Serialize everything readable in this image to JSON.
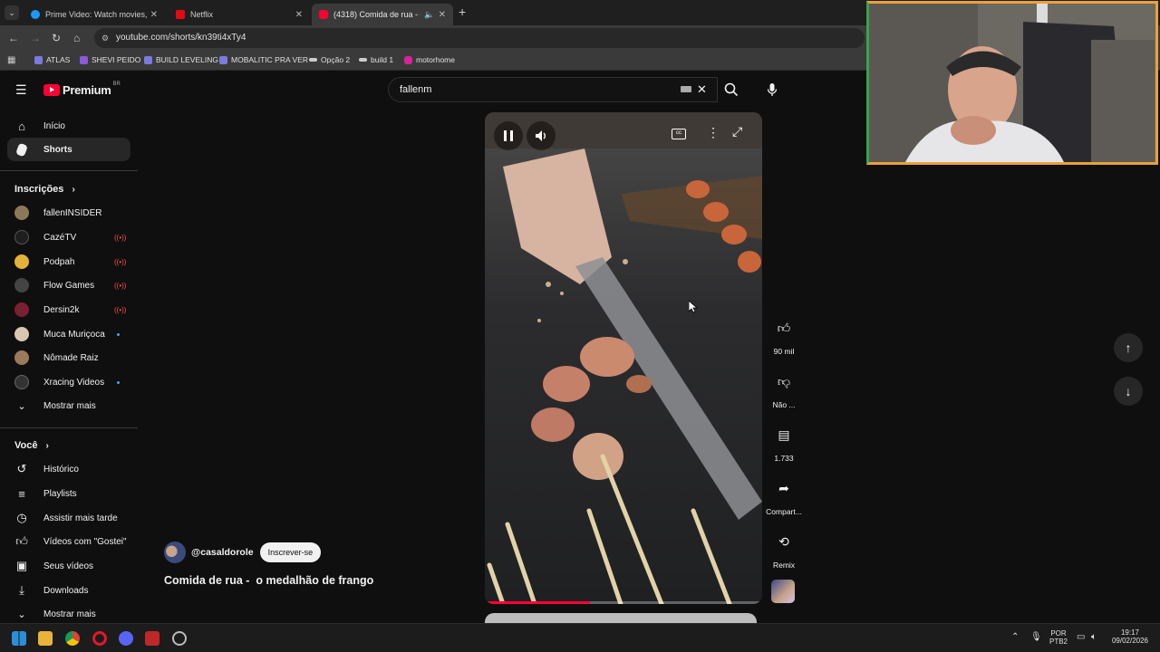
{
  "browser": {
    "tabs": [
      {
        "title": "Prime Video: Watch movies, TV",
        "favicon_color": "#1a98ff"
      },
      {
        "title": "Netflix",
        "favicon_color": "#e50914"
      },
      {
        "title": "(4318) Comida de rua - o m",
        "favicon_color": "#ff0033"
      }
    ],
    "url": "youtube.com/shorts/kn39ti4xTy4",
    "bookmarks": [
      {
        "label": "ATLAS",
        "color": "#7a7adf"
      },
      {
        "label": "SHEVI PEIDO",
        "color": "#8a5ad8"
      },
      {
        "label": "BUILD LEVELING",
        "color": "#7a7adf"
      },
      {
        "label": "MOBALITIC PRA VER",
        "color": "#7a7adf"
      },
      {
        "label": "Opção 2",
        "color": "#cccccc"
      },
      {
        "label": "build 1",
        "color": "#cccccc"
      },
      {
        "label": "motorhome",
        "color": "#d6249f"
      }
    ]
  },
  "youtube": {
    "logo_text": "Premium",
    "logo_badge": "BR",
    "search_value": "fallenm",
    "sidebar": {
      "main": [
        {
          "label": "Início",
          "icon": "home-icon"
        },
        {
          "label": "Shorts",
          "icon": "shorts-icon"
        }
      ],
      "subscriptions_title": "Inscrições",
      "subscriptions": [
        {
          "label": "fallenINSIDER",
          "avatar_color": "#8a7a5a",
          "status": ""
        },
        {
          "label": "CazéTV",
          "avatar_color": "#1e1e1e",
          "status": "live"
        },
        {
          "label": "Podpah",
          "avatar_color": "#e2b23a",
          "status": "live"
        },
        {
          "label": "Flow Games",
          "avatar_color": "#444444",
          "status": "live"
        },
        {
          "label": "Dersin2k",
          "avatar_color": "#7a2030",
          "status": "live"
        },
        {
          "label": "Muca Muriçoca",
          "avatar_color": "#d8c8b0",
          "status": "new"
        },
        {
          "label": "Nômade Raiz",
          "avatar_color": "#9a7a5a",
          "status": ""
        },
        {
          "label": "Xracing Videos",
          "avatar_color": "#333333",
          "status": "new"
        }
      ],
      "show_more": "Mostrar mais",
      "you_title": "Você",
      "you_items": [
        {
          "label": "Histórico",
          "icon": "history-icon"
        },
        {
          "label": "Playlists",
          "icon": "playlists-icon"
        },
        {
          "label": "Assistir mais tarde",
          "icon": "watch-later-icon"
        },
        {
          "label": "Vídeos com \"Gostei\"",
          "icon": "thumb-up-icon"
        },
        {
          "label": "Seus vídeos",
          "icon": "your-videos-icon"
        },
        {
          "label": "Downloads",
          "icon": "download-icon"
        }
      ],
      "show_more_2": "Mostrar mais"
    },
    "short": {
      "channel": "@casaldorole",
      "subscribe_label": "Inscrever-se",
      "title": "Comida de rua -  o medalhão de frango",
      "progress": 0.38,
      "actions": [
        {
          "label": "90 mil",
          "icon": "thumb-up-icon"
        },
        {
          "label": "Não ...",
          "icon": "thumb-down-icon"
        },
        {
          "label": "1.733",
          "icon": "comment-icon"
        },
        {
          "label": "Compart...",
          "icon": "share-icon"
        },
        {
          "label": "Remix",
          "icon": "remix-icon"
        }
      ]
    }
  },
  "taskbar": {
    "lang_top": "POR",
    "lang_bottom": "PTB2",
    "time": "19:17",
    "date": "09/02/2026"
  }
}
